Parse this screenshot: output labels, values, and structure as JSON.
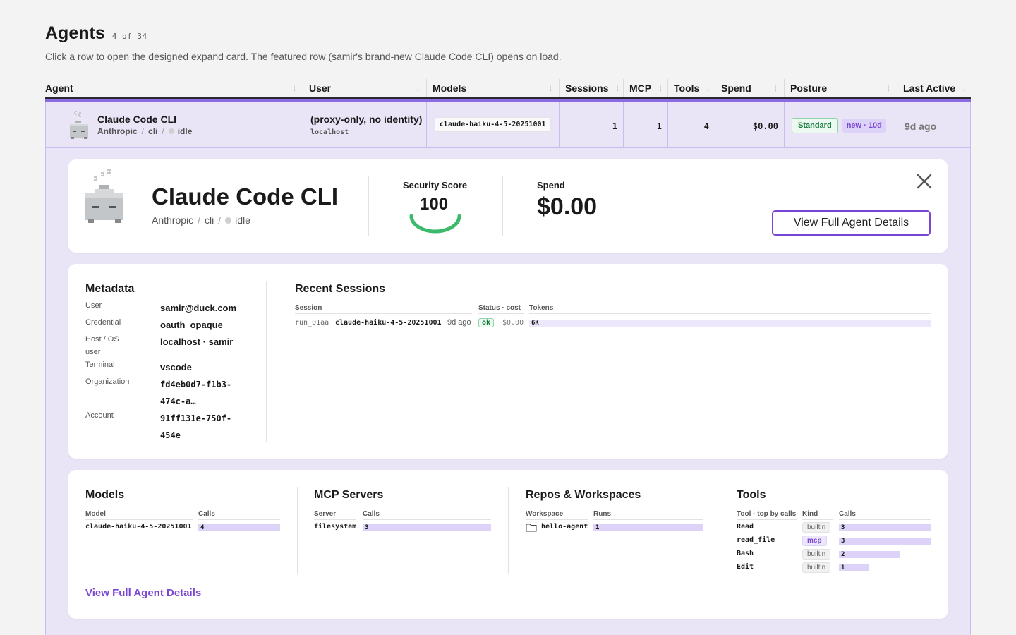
{
  "header": {
    "title": "Agents",
    "count": "4 of 34",
    "subtitle": "Click a row to open the designed expand card. The featured row (samir's brand-new Claude Code CLI) opens on load."
  },
  "table": {
    "columns": [
      "Agent",
      "User",
      "Models",
      "Sessions",
      "MCP",
      "Tools",
      "Spend",
      "Posture",
      "Last Active"
    ],
    "row": {
      "agent_name": "Claude Code CLI",
      "vendor": "Anthropic",
      "kind": "cli",
      "status": "idle",
      "user": "(proxy-only, no identity)",
      "host": "localhost",
      "model": "claude-haiku-4-5-20251001",
      "sessions": "1",
      "mcp": "1",
      "tools": "4",
      "spend": "$0.00",
      "posture": "Standard",
      "age_badge": "new · 10d",
      "last_active": "9d ago"
    }
  },
  "detail": {
    "name": "Claude Code CLI",
    "vendor": "Anthropic",
    "kind": "cli",
    "status": "idle",
    "security_label": "Security Score",
    "security_score": 100,
    "spend_label": "Spend",
    "spend": "$0.00",
    "view_button": "View Full Agent Details",
    "metadata": {
      "title": "Metadata",
      "rows": [
        {
          "key": "User",
          "value": "samir@duck.com"
        },
        {
          "key": "Credential",
          "value": "oauth_opaque"
        },
        {
          "key": "Host / OS user",
          "value": "localhost · samir"
        },
        {
          "key": "Terminal",
          "value": "vscode"
        },
        {
          "key": "Organization",
          "value": "fd4eb0d7-f1b3-474c-a…"
        },
        {
          "key": "Account",
          "value": "91ff131e-750f-454e"
        }
      ]
    },
    "sessions": {
      "title": "Recent Sessions",
      "headers": [
        "Session",
        "Status · cost",
        "Tokens"
      ],
      "rows": [
        {
          "id": "run_01aa",
          "model": "claude-haiku-4-5-20251001",
          "age": "9d ago",
          "status": "ok",
          "cost": "$0.00",
          "tokens": "6K"
        }
      ]
    },
    "models": {
      "title": "Models",
      "headers": [
        "Model",
        "Calls"
      ],
      "rows": [
        {
          "name": "claude-haiku-4-5-20251001",
          "calls": 4
        }
      ]
    },
    "mcp": {
      "title": "MCP Servers",
      "headers": [
        "Server",
        "Calls"
      ],
      "rows": [
        {
          "name": "filesystem",
          "calls": 3
        }
      ]
    },
    "repos": {
      "title": "Repos & Workspaces",
      "headers": [
        "Workspace",
        "Runs"
      ],
      "rows": [
        {
          "name": "hello-agent",
          "runs": 1
        }
      ]
    },
    "tools": {
      "title": "Tools",
      "headers": [
        "Tool · top by calls",
        "Kind",
        "Calls"
      ],
      "rows": [
        {
          "name": "Read",
          "kind": "builtin",
          "calls": 3
        },
        {
          "name": "read_file",
          "kind": "mcp",
          "calls": 3
        },
        {
          "name": "Bash",
          "kind": "builtin",
          "calls": 2
        },
        {
          "name": "Edit",
          "kind": "builtin",
          "calls": 1
        }
      ]
    },
    "footer_link": "View Full Agent Details"
  },
  "colors": {
    "accent": "#7a45d3",
    "row_highlight": "#e9e5f7",
    "score_green": "#3cba6b"
  },
  "icons": [
    "robot-avatar-icon",
    "sleep-zzz-icon",
    "sort-arrow-icon",
    "close-icon",
    "folder-icon"
  ]
}
